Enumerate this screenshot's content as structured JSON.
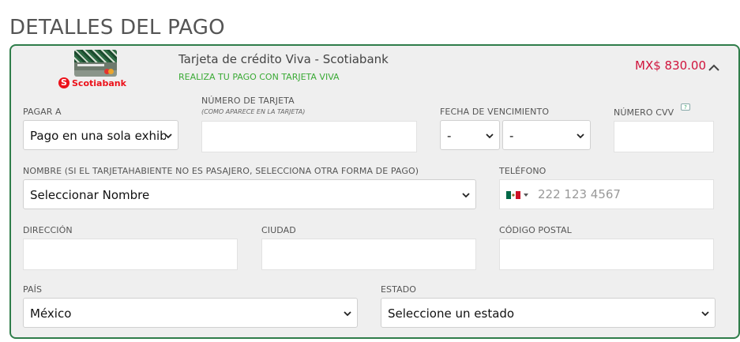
{
  "page": {
    "title": "DETALLES DEL PAGO"
  },
  "payment": {
    "card_title": "Tarjeta de crédito Viva - Scotiabank",
    "promo": "REALIZA TU PAGO CON TARJETA VIVA",
    "amount": "MX$ 830.00",
    "bank_logo_text": "Scotiabank",
    "bank_logo_mark": "S",
    "collapse_icon": "chevron-up-icon"
  },
  "form": {
    "pay_in": {
      "label": "PAGAR A",
      "value": "Pago en una sola exhibición"
    },
    "card_number": {
      "label": "NÚMERO DE TARJETA",
      "hint": "(COMO APARECE EN LA TARJETA)",
      "value": ""
    },
    "expiry": {
      "label": "FECHA DE VENCIMIENTO",
      "month": "-",
      "year": "-"
    },
    "cvv": {
      "label": "NÚMERO CVV",
      "help": "?",
      "value": ""
    },
    "name": {
      "label": "NOMBRE (SI EL TARJETAHABIENTE NO ES PASAJERO, SELECCIONA OTRA FORMA DE PAGO)",
      "value": "Seleccionar Nombre"
    },
    "phone": {
      "label": "TELÉFONO",
      "placeholder": "222 123 4567",
      "country": "mexico-flag-icon"
    },
    "address": {
      "label": "DIRECCIÓN",
      "value": ""
    },
    "city": {
      "label": "CIUDAD",
      "value": ""
    },
    "zip": {
      "label": "CÓDIGO POSTAL",
      "value": ""
    },
    "country": {
      "label": "PAÍS",
      "value": "México"
    },
    "state": {
      "label": "ESTADO",
      "value": "Seleccione un estado"
    }
  },
  "colors": {
    "border": "#2f7d4a",
    "amount": "#d0143c",
    "promo": "#3aaa35",
    "bank": "#ec111a",
    "panel_bg": "#efefef"
  }
}
